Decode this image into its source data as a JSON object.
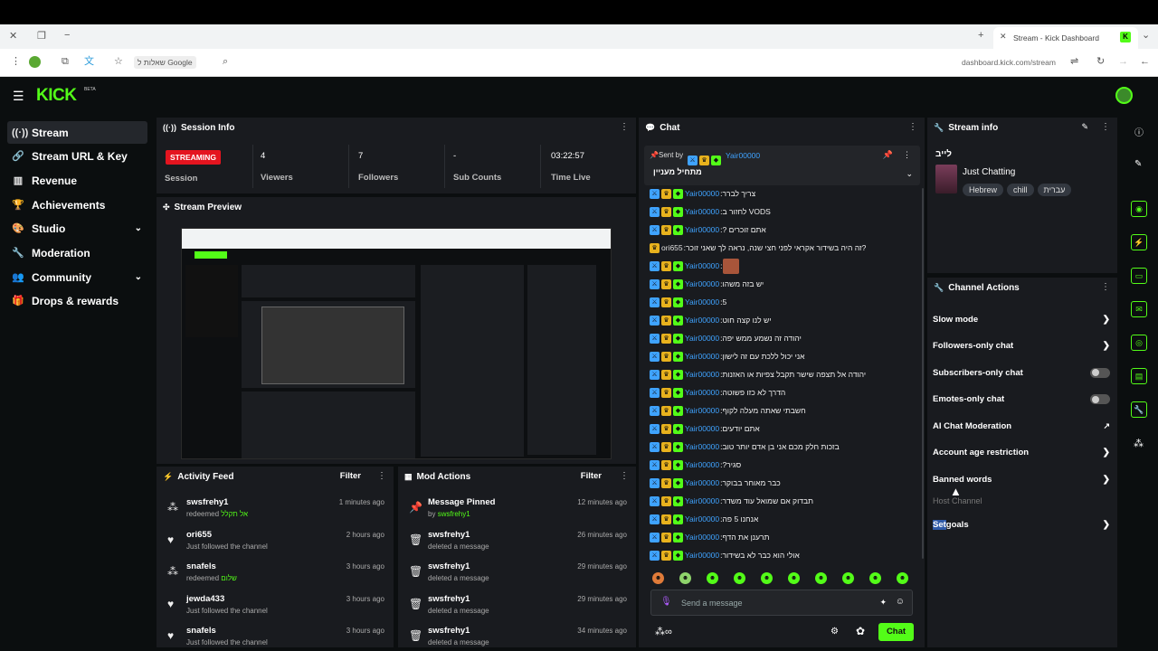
{
  "browser": {
    "tab_title": "Stream - Kick Dashboard",
    "address": "dashboard.kick.com/stream",
    "search_chip": "שאלות ל Google"
  },
  "app": {
    "logo": "KICK",
    "logo_sup": "BETA"
  },
  "sidebar": {
    "items": [
      {
        "label": "Stream",
        "icon": "stream-icon"
      },
      {
        "label": "Stream URL & Key",
        "icon": "link-icon"
      },
      {
        "label": "Revenue",
        "icon": "revenue-icon"
      },
      {
        "label": "Achievements",
        "icon": "trophy-icon"
      },
      {
        "label": "Studio",
        "icon": "studio-icon"
      },
      {
        "label": "Moderation",
        "icon": "wrench-icon"
      },
      {
        "label": "Community",
        "icon": "community-icon"
      },
      {
        "label": "Drops & rewards",
        "icon": "gift-icon"
      }
    ]
  },
  "session": {
    "title": "Session Info",
    "status": "STREAMING",
    "status_label": "Session",
    "viewers_value": "4",
    "viewers_label": "Viewers",
    "followers_value": "7",
    "followers_label": "Followers",
    "subs_value": "-",
    "subs_label": "Sub Counts",
    "time_value": "03:22:57",
    "time_label": "Time Live"
  },
  "preview": {
    "title": "Stream Preview"
  },
  "activity": {
    "title": "Activity Feed",
    "filter": "Filter",
    "rows": [
      {
        "name": "swsfrehy1",
        "desc": "redeemed",
        "desc_hl": "אל תקלל",
        "time": "1 minutes ago",
        "icon": "redeem-icon"
      },
      {
        "name": "ori655",
        "desc": "Just followed the channel",
        "desc_hl": "",
        "time": "2 hours ago",
        "icon": "heart-icon"
      },
      {
        "name": "snafels",
        "desc": "redeemed",
        "desc_hl": "שלום",
        "time": "3 hours ago",
        "icon": "redeem-icon"
      },
      {
        "name": "jewda433",
        "desc": "Just followed the channel",
        "desc_hl": "",
        "time": "3 hours ago",
        "icon": "heart-icon"
      },
      {
        "name": "snafels",
        "desc": "Just followed the channel",
        "desc_hl": "",
        "time": "3 hours ago",
        "icon": "heart-icon"
      }
    ]
  },
  "mod": {
    "title": "Mod Actions",
    "filter": "Filter",
    "rows": [
      {
        "name": "Message Pinned",
        "desc": "by",
        "desc_hl": "swsfrehy1",
        "time": "12 minutes ago",
        "icon": "pin-icon"
      },
      {
        "name": "swsfrehy1",
        "desc": "deleted a message",
        "desc_hl": "",
        "time": "26 minutes ago",
        "icon": "trash-icon"
      },
      {
        "name": "swsfrehy1",
        "desc": "deleted a message",
        "desc_hl": "",
        "time": "29 minutes ago",
        "icon": "trash-icon"
      },
      {
        "name": "swsfrehy1",
        "desc": "deleted a message",
        "desc_hl": "",
        "time": "29 minutes ago",
        "icon": "trash-icon"
      },
      {
        "name": "swsfrehy1",
        "desc": "deleted a message",
        "desc_hl": "",
        "time": "34 minutes ago",
        "icon": "trash-icon"
      }
    ]
  },
  "chat": {
    "title": "Chat",
    "pinned_sent_by": "Sent by",
    "pinned_user": "Yair00000",
    "pinned_text": "מתחיל מעניין",
    "messages": [
      {
        "user": "Yair00000",
        "text": "צריך לברר",
        "alt": false
      },
      {
        "user": "Yair00000",
        "text": "לחזור ב VODS",
        "alt": false
      },
      {
        "user": "Yair00000",
        "text": "? אתם זוכרים",
        "alt": false
      },
      {
        "user": "ori655",
        "text": "זה היה בשידור אקראי לפני חצי שנה, נראה לך שאני זוכר?",
        "alt": true
      },
      {
        "user": "Yair00000",
        "text": "",
        "alt": false,
        "emote": true
      },
      {
        "user": "Yair00000",
        "text": "יש בזה משהו",
        "alt": false
      },
      {
        "user": "Yair00000",
        "text": "5",
        "alt": false
      },
      {
        "user": "Yair00000",
        "text": "יש לנו קצה חוט",
        "alt": false
      },
      {
        "user": "Yair00000",
        "text": "יהודה זה נשמע ממש יפה",
        "alt": false
      },
      {
        "user": "Yair00000",
        "text": "אני יכול ללכת עם זה לישון",
        "alt": false
      },
      {
        "user": "Yair00000",
        "text": "יהודה אל תצפה שישר תקבל צפיות או האזנות",
        "alt": false
      },
      {
        "user": "Yair00000",
        "text": "הדרך לא כזו פשוטה",
        "alt": false
      },
      {
        "user": "Yair00000",
        "text": "חשבתי שאתה מעלה לקוף",
        "alt": false
      },
      {
        "user": "Yair00000",
        "text": "אתם יודעים",
        "alt": false
      },
      {
        "user": "Yair00000",
        "text": "בזכות חלק מכם אני בן אדם יותר טוב",
        "alt": false
      },
      {
        "user": "Yair00000",
        "text": "?סגיר",
        "alt": false
      },
      {
        "user": "Yair00000",
        "text": "כבר מאוחר בבוקר",
        "alt": false
      },
      {
        "user": "Yair00000",
        "text": "תבדוק אם שמואל עוד משדר",
        "alt": false
      },
      {
        "user": "Yair00000",
        "text": "אנחנו 5 פה",
        "alt": false
      },
      {
        "user": "Yair00000",
        "text": "תרענן את הדף",
        "alt": false
      },
      {
        "user": "Yair00000",
        "text": "אולי הוא כבר לא בשידור",
        "alt": false
      }
    ],
    "input_placeholder": "Send a message",
    "chat_button": "Chat"
  },
  "stream_info": {
    "title": "Stream info",
    "stream_title": "לייב",
    "category": "Just Chatting",
    "tags": [
      "Hebrew",
      "chill",
      "עברית"
    ]
  },
  "channel_actions": {
    "title": "Channel Actions",
    "items": [
      {
        "label": "Slow mode",
        "control": "arrow"
      },
      {
        "label": "Followers-only chat",
        "control": "arrow"
      },
      {
        "label": "Subscribers-only chat",
        "control": "toggle"
      },
      {
        "label": "Emotes-only chat",
        "control": "toggle"
      },
      {
        "label": "AI Chat Moderation",
        "control": "external"
      },
      {
        "label": "Account age restriction",
        "control": "arrow"
      },
      {
        "label": "Banned words",
        "control": "arrow"
      }
    ],
    "host_channel": "Host Channel",
    "set_goals_a": "Set",
    "set_goals_b": " goals"
  },
  "colors": {
    "accent": "#53fc18",
    "streaming": "#e4141f",
    "panel": "#191b1f",
    "bg": "#0b0e0f",
    "link": "#3fa3ff"
  }
}
